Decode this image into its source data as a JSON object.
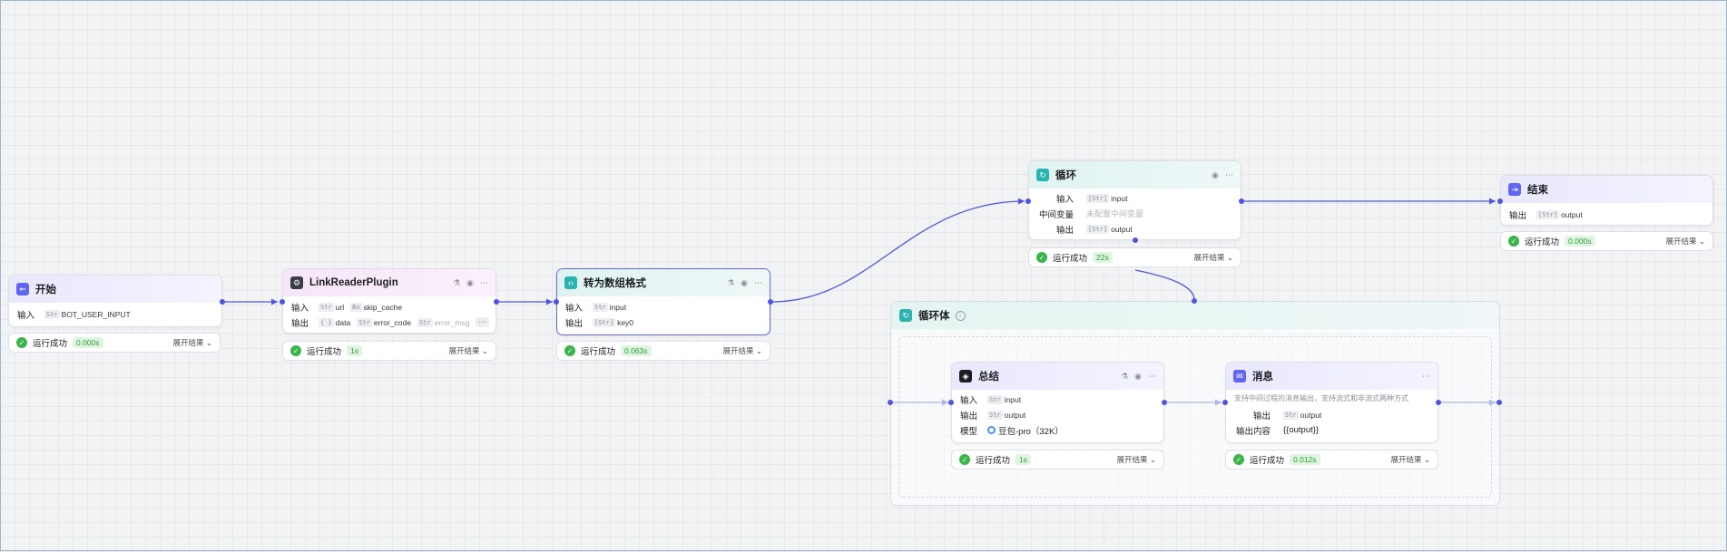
{
  "common": {
    "input_label": "输入",
    "output_label": "输出",
    "status_text": "运行成功",
    "expand_label": "展开结果",
    "type_str": "Str",
    "type_obj": "{ }",
    "type_arr_obj": "[{}]",
    "type_arr_str": "[Str]",
    "type_bool": "Bo"
  },
  "nodes": {
    "start": {
      "title": "开始",
      "output_var": "BOT_USER_INPUT",
      "time": "0.000s"
    },
    "link": {
      "title": "LinkReaderPlugin",
      "in_url": "url",
      "in_skip": "skip_cache",
      "out_data": "data",
      "out_err": "error_code",
      "out_err_msg": "error_msg",
      "time": "1s"
    },
    "convert": {
      "title": "转为数组格式",
      "in_var": "input",
      "out_var": "key0",
      "time": "0.063s"
    },
    "loop": {
      "title": "循环",
      "mid_label": "中间变量",
      "mid_placeholder": "未配置中间变量",
      "in_var": "input",
      "out_var": "output",
      "time": "22s"
    },
    "end": {
      "title": "结束",
      "out_var": "output",
      "time": "0.000s"
    },
    "loop_body": {
      "title": "循环体",
      "info_icon": "i"
    },
    "summary": {
      "title": "总结",
      "in_var": "input",
      "out_var": "output",
      "model_label": "模型",
      "model_value": "豆包-pro（32K）",
      "time": "1s"
    },
    "message": {
      "title": "消息",
      "description": "支持中间过程的消息输出，支持流式和非流式两种方式",
      "out_var": "output",
      "content_label": "输出内容",
      "content_value": "{{output}}",
      "time": "0.012s"
    }
  },
  "colors": {
    "edge": "#4f55e0",
    "accent": "#6166f0",
    "success": "#3ab54a"
  }
}
